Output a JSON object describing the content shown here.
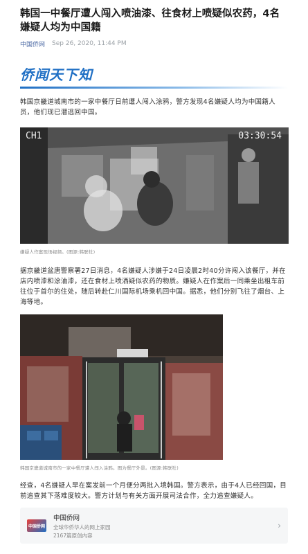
{
  "article": {
    "headline": "韩国一中餐厅遭人闯入喷油漆、往食材上喷疑似农药，4名嫌疑人均为中国籍",
    "source": "中国侨网",
    "timestamp": "Sep 26, 2020, 11:44 PM"
  },
  "banner": {
    "brand_text": "侨闻天下知"
  },
  "paragraphs": {
    "p1": "韩国京畿道城南市的一家中餐厅日前遭人闯入涂鸦，警方发现4名嫌疑人均为中国籍人员，他们现已潜逃回中国。",
    "p2": "据京畿道盆唐警察署27日消息，4名嫌疑人涉嫌于24日凌晨2时40分许闯入该餐厅，并在店内喷漆和涂油漆，还在食材上喷洒疑似农药的物质。嫌疑人在作案后一同乘坐出租车前往位于首尔的住处，随后转赴仁川国际机场乘机回中国。据悉，他们分别飞往了烟台、上海等地。",
    "p3": "经查，4名嫌疑人早在案发前一个月便分两批入境韩国。警方表示，由于4人已经回国，目前追查其下落难度较大。警方计划与有关方面开展司法合作，全力追查嫌疑人。"
  },
  "figure1": {
    "channel": "CH1",
    "time": "03:30:54",
    "caption": "嫌疑人作案现场视频。(图源:韩联社)"
  },
  "figure2": {
    "caption": "韩国京畿道城南市的一家中餐厅遭人闯入涂鸦。图为餐厅外景。(图源:韩联社)"
  },
  "footer": {
    "logo_text": "中国侨网",
    "name": "中国侨网",
    "desc": "全球华侨华人的网上家园",
    "count": "2167篇原创内容",
    "chevron_icon": "chevron-right-icon"
  },
  "colors": {
    "brand_blue": "#1f6fc4",
    "source_link": "#5470a8"
  }
}
